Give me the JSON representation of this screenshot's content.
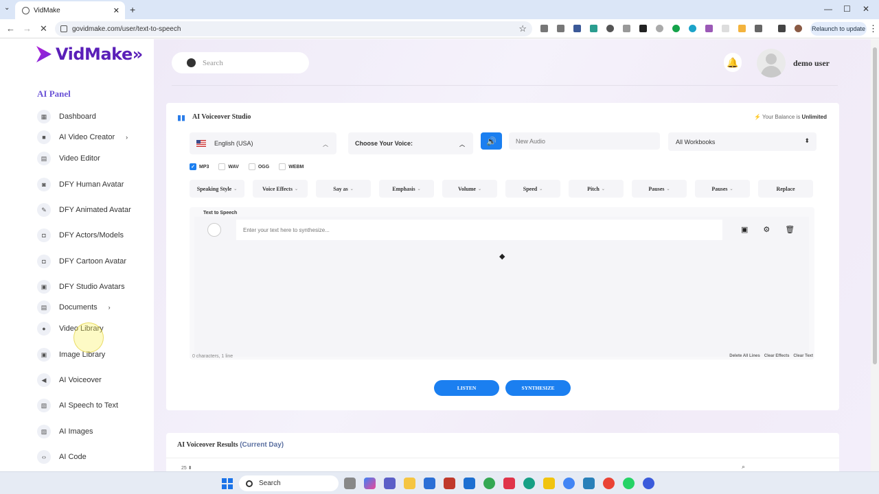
{
  "browser": {
    "tab_title": "VidMake",
    "url": "govidmake.com/user/text-to-speech",
    "relaunch_label": "Relaunch to update",
    "new_tab": "+",
    "close_tab": "✕",
    "win_min": "—",
    "win_max": "☐",
    "win_close": "✕",
    "tab_menu": "⌄",
    "back": "←",
    "forward": "→",
    "reload": "✕",
    "menu": "⋮"
  },
  "sidebar": {
    "logo": "VidMake»",
    "panel_title": "AI Panel",
    "items": [
      {
        "label": "Dashboard",
        "icon": "dashboard-icon",
        "glyph": "▦",
        "chevron": ""
      },
      {
        "label": "AI Video Creator",
        "icon": "video-camera-icon",
        "glyph": "■",
        "chevron": "›"
      },
      {
        "label": "Video Editor",
        "icon": "film-icon",
        "glyph": "▤",
        "chevron": ""
      },
      {
        "label": "DFY Human Avatar",
        "icon": "person-icon",
        "glyph": "◙",
        "chevron": ""
      },
      {
        "label": "DFY Animated Avatar",
        "icon": "pencil-icon",
        "glyph": "✎",
        "chevron": ""
      },
      {
        "label": "DFY Actors/Models",
        "icon": "contact-icon",
        "glyph": "◘",
        "chevron": ""
      },
      {
        "label": "DFY Cartoon Avatar",
        "icon": "contact-card-icon",
        "glyph": "◘",
        "chevron": ""
      },
      {
        "label": "DFY Studio Avatars",
        "icon": "badge-icon",
        "glyph": "▣",
        "chevron": ""
      },
      {
        "label": "Documents",
        "icon": "document-icon",
        "glyph": "▤",
        "chevron": "›"
      },
      {
        "label": "Video Library",
        "icon": "play-circle-icon",
        "glyph": "●",
        "chevron": ""
      },
      {
        "label": "Image Library",
        "icon": "image-icon",
        "glyph": "▣",
        "chevron": ""
      },
      {
        "label": "AI Voiceover",
        "icon": "megaphone-icon",
        "glyph": "◀",
        "chevron": ""
      },
      {
        "label": "AI Speech to Text",
        "icon": "transcribe-icon",
        "glyph": "▧",
        "chevron": ""
      },
      {
        "label": "AI Images",
        "icon": "picture-icon",
        "glyph": "▨",
        "chevron": ""
      },
      {
        "label": "AI Code",
        "icon": "code-icon",
        "glyph": "‹›",
        "chevron": ""
      }
    ]
  },
  "header": {
    "search_placeholder": "Search",
    "username": "demo user"
  },
  "studio": {
    "title": "AI Voiceover Studio",
    "balance_prefix": "Your Balance is",
    "balance_value": "Unlimited",
    "language": "English (USA)",
    "voice_placeholder": "Choose Your Voice:",
    "audio_name_placeholder": "New Audio",
    "workbook": "All Workbooks",
    "formats": [
      {
        "label": "MP3",
        "checked": true
      },
      {
        "label": "WAV",
        "checked": false
      },
      {
        "label": "OGG",
        "checked": false
      },
      {
        "label": "WEBM",
        "checked": false
      }
    ],
    "effects": [
      "Speaking Style",
      "Voice Effects",
      "Say as",
      "Emphasis",
      "Volume",
      "Speed",
      "Pitch",
      "Pauses",
      "Pauses",
      "Replace"
    ],
    "tts_label": "Text to Speech",
    "tts_placeholder": "Enter your text here to synthesize...",
    "char_count": "0 characters, 1 line",
    "links": [
      "Delete All Lines",
      "Clear Effects",
      "Clear Text"
    ],
    "listen_label": "LISTEN",
    "synthesize_label": "SYNTHESIZE"
  },
  "results": {
    "title": "AI Voiceover Results",
    "subtitle": "(Current Day)",
    "page_size": "25"
  },
  "taskbar": {
    "search_label": "Search"
  },
  "colors": {
    "accent": "#1b7ff0",
    "brand": "#5a1fb8"
  }
}
